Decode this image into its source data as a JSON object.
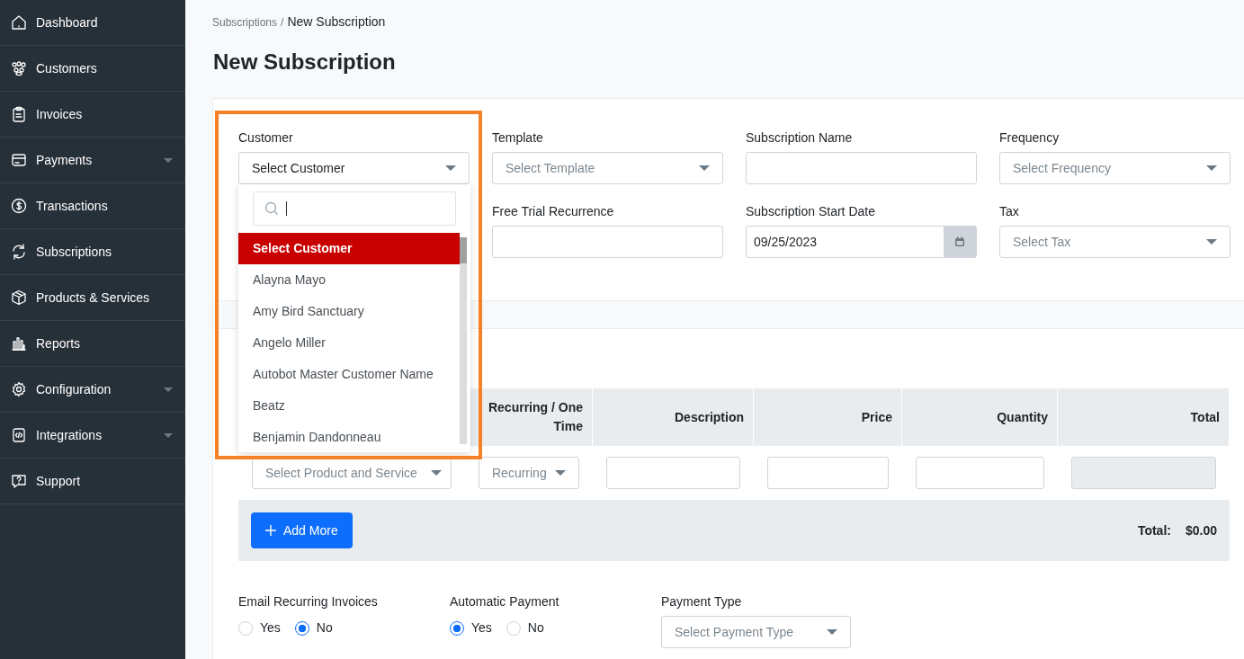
{
  "sidebar": {
    "items": [
      {
        "label": "Dashboard",
        "has_submenu": false
      },
      {
        "label": "Customers",
        "has_submenu": false
      },
      {
        "label": "Invoices",
        "has_submenu": false
      },
      {
        "label": "Payments",
        "has_submenu": true
      },
      {
        "label": "Transactions",
        "has_submenu": false
      },
      {
        "label": "Subscriptions",
        "has_submenu": false
      },
      {
        "label": "Products & Services",
        "has_submenu": false
      },
      {
        "label": "Reports",
        "has_submenu": false
      },
      {
        "label": "Configuration",
        "has_submenu": true
      },
      {
        "label": "Integrations",
        "has_submenu": true
      },
      {
        "label": "Support",
        "has_submenu": false
      }
    ]
  },
  "breadcrumb": [
    {
      "label": "Subscriptions"
    },
    {
      "label": "New Subscription"
    }
  ],
  "breadcrumb_separator": "/",
  "page_title": "New Subscription",
  "form_rows": [
    [
      {
        "label": "Customer",
        "kind": "select",
        "value": "Select Customer",
        "highlighted": true,
        "open": true
      },
      {
        "label": "Template",
        "kind": "select",
        "placeholder": "Select Template"
      },
      {
        "label": "Subscription Name",
        "kind": "input"
      },
      {
        "label": "Frequency",
        "kind": "select",
        "placeholder": "Select Frequency"
      }
    ],
    [
      {
        "label": "Free Trial Recurrence",
        "kind": "input"
      },
      {
        "label": "Subscription Start Date",
        "kind": "date",
        "value": "09/25/2023"
      },
      {
        "label": "Tax",
        "kind": "select",
        "placeholder": "Select Tax"
      }
    ]
  ],
  "customer_dropdown": {
    "options": [
      {
        "label": "Select Customer",
        "selected": true
      },
      {
        "label": "Alayna Mayo",
        "selected": false
      },
      {
        "label": "Amy Bird Sanctuary",
        "selected": false
      },
      {
        "label": "Angelo Miller",
        "selected": false
      },
      {
        "label": "Autobot Master Customer Name",
        "selected": false
      },
      {
        "label": "Beatz",
        "selected": false
      },
      {
        "label": "Benjamin Dandonneau",
        "selected": false
      }
    ]
  },
  "table": {
    "columns": [
      {
        "label": "Recurring / One Time"
      },
      {
        "label": "Description"
      },
      {
        "label": "Price"
      },
      {
        "label": "Quantity"
      },
      {
        "label": "Total"
      }
    ],
    "row": [
      {
        "kind": "select",
        "placeholder": "Select Product and Service"
      },
      {
        "kind": "select",
        "placeholder": "Recurring"
      },
      {
        "kind": "input"
      },
      {
        "kind": "input"
      },
      {
        "kind": "input"
      },
      {
        "kind": "input",
        "disabled": true
      }
    ]
  },
  "add_button": "Add More",
  "total": {
    "label": "Total:",
    "value": "$0.00"
  },
  "radio_groups": [
    {
      "label": "Email Recurring Invoices",
      "options": [
        {
          "label": "Yes",
          "selected": false
        },
        {
          "label": "No",
          "selected": true
        }
      ]
    },
    {
      "label": "Automatic Payment",
      "options": [
        {
          "label": "Yes",
          "selected": true
        },
        {
          "label": "No",
          "selected": false
        }
      ]
    }
  ],
  "payment_type": {
    "label": "Payment Type",
    "placeholder": "Select Payment Type"
  }
}
